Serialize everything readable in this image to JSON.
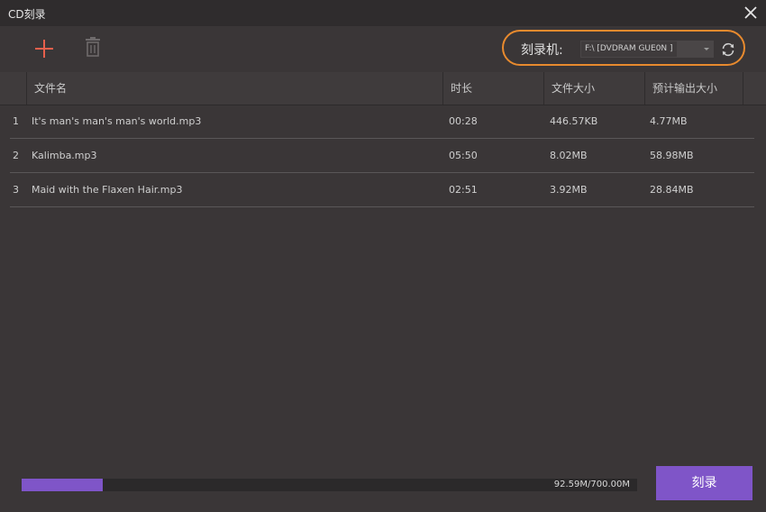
{
  "window": {
    "title": "CD刻录"
  },
  "toolbar": {
    "add_icon": "plus-icon",
    "delete_icon": "trash-icon",
    "burner_label": "刻录机:",
    "burner_value": "F:\\ [DVDRAM GUE0N    ]",
    "refresh_icon": "refresh-icon",
    "accent_color": "#e88a2e"
  },
  "table": {
    "headers": [
      "文件名",
      "时长",
      "文件大小",
      "预计输出大小"
    ],
    "rows": [
      {
        "index": "1",
        "name": "It's man's man's man's world.mp3",
        "duration": "00:28",
        "size": "446.57KB",
        "estimated": "4.77MB"
      },
      {
        "index": "2",
        "name": "Kalimba.mp3",
        "duration": "05:50",
        "size": "8.02MB",
        "estimated": "58.98MB"
      },
      {
        "index": "3",
        "name": "Maid with the Flaxen Hair.mp3",
        "duration": "02:51",
        "size": "3.92MB",
        "estimated": "28.84MB"
      }
    ]
  },
  "footer": {
    "capacity_text": "92.59M/700.00M",
    "capacity_used_fraction": 0.1323,
    "burn_label": "刻录",
    "primary_color": "#7f55c8"
  }
}
